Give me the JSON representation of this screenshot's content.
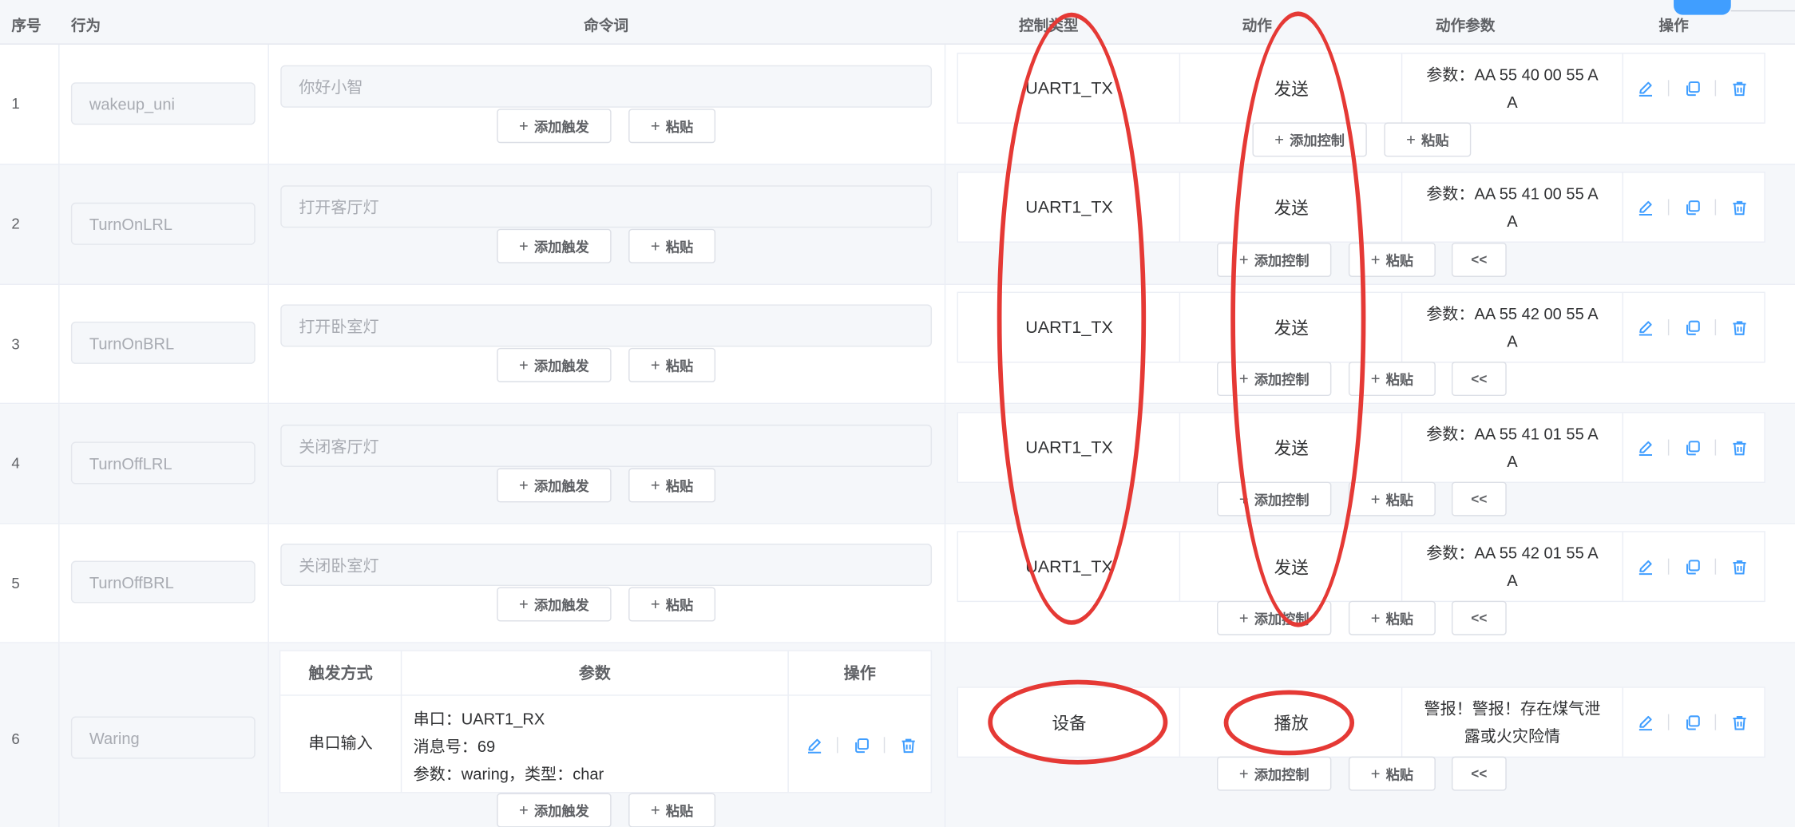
{
  "header": {
    "index": "序号",
    "behavior": "行为",
    "command": "命令词",
    "control_type": "控制类型",
    "action": "动作",
    "action_params": "动作参数",
    "operations": "操作"
  },
  "buttons": {
    "add_trigger": "添加触发",
    "paste": "粘贴",
    "add_control": "添加控制",
    "collapse": "<<",
    "plus": "+"
  },
  "rows": [
    {
      "index": "1",
      "behavior": "wakeup_uni",
      "command": "你好小智",
      "control_type": "UART1_TX",
      "action": "发送",
      "param_line1": "参数：AA 55 40 00 55 A",
      "param_line2": "A"
    },
    {
      "index": "2",
      "behavior": "TurnOnLRL",
      "command": "打开客厅灯",
      "control_type": "UART1_TX",
      "action": "发送",
      "param_line1": "参数：AA 55 41 00 55 A",
      "param_line2": "A"
    },
    {
      "index": "3",
      "behavior": "TurnOnBRL",
      "command": "打开卧室灯",
      "control_type": "UART1_TX",
      "action": "发送",
      "param_line1": "参数：AA 55 42 00 55 A",
      "param_line2": "A"
    },
    {
      "index": "4",
      "behavior": "TurnOffLRL",
      "command": "关闭客厅灯",
      "control_type": "UART1_TX",
      "action": "发送",
      "param_line1": "参数：AA 55 41 01 55 A",
      "param_line2": "A"
    },
    {
      "index": "5",
      "behavior": "TurnOffBRL",
      "command": "关闭卧室灯",
      "control_type": "UART1_TX",
      "action": "发送",
      "param_line1": "参数：AA 55 42 01 55 A",
      "param_line2": "A"
    },
    {
      "index": "6",
      "behavior": "Waring",
      "control_type": "设备",
      "action": "播放",
      "param_line1": "警报！警报！存在煤气泄",
      "param_line2": "露或火灾险情"
    }
  ],
  "trigger_table": {
    "col_method": "触发方式",
    "col_params": "参数",
    "col_ops": "操作",
    "method": "串口输入",
    "param_line1": "串口：UART1_RX",
    "param_line2": "消息号：69",
    "param_line3": "参数：waring，类型：char"
  },
  "icons": [
    "edit-icon",
    "copy-icon",
    "delete-icon"
  ],
  "colors": {
    "accent": "#409eff",
    "annotation": "#e53935",
    "header_bg": "#f5f7fa"
  }
}
